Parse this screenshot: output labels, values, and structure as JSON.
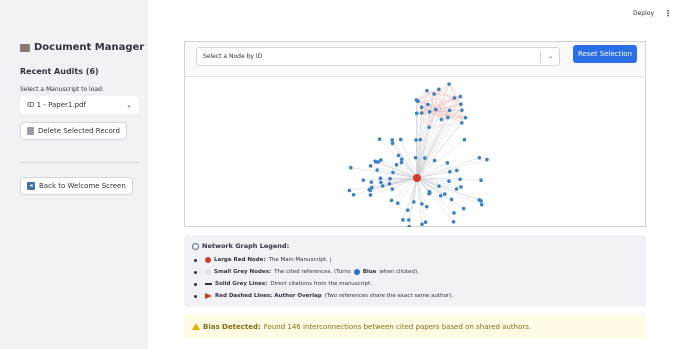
{
  "header": {
    "deploy_label": "Deploy",
    "menu_glyph": "⋮"
  },
  "sidebar": {
    "title": "Document Manager",
    "recent_audits": "Recent Audits (6)",
    "select_label": "Select a Manuscript to load:",
    "selected_manuscript": "ID 1 - Paper1.pdf",
    "delete_label": "Delete Selected Record",
    "back_label": "Back to Welcome Screen"
  },
  "main": {
    "node_select_placeholder": "Select a Node by ID",
    "reset_label": "Reset Selection"
  },
  "legend": {
    "title": "Network Graph Legend:",
    "items": [
      {
        "bold": "Large Red Node:",
        "text": "The Main Manuscript. |"
      },
      {
        "bold": "Small Grey Nodes:",
        "text": "The cited references. (Turns",
        "bold2": "Blue",
        "text2": "when clicked)."
      },
      {
        "bold": "Solid Grey Lines:",
        "text": "Direct citations from the manuscript."
      },
      {
        "bold": "Red Dashed Lines: Author Overlap",
        "text": "(Two references share the exact same author)."
      }
    ]
  },
  "alert": {
    "bold": "Bias Detected:",
    "text": "Found 146 interconnections between cited papers based on shared authors."
  },
  "colors": {
    "accent": "#2b6fe8",
    "main_node": "#d63a2c",
    "ref_node": "#3b82c4",
    "alert_bg": "#fffbe5"
  }
}
